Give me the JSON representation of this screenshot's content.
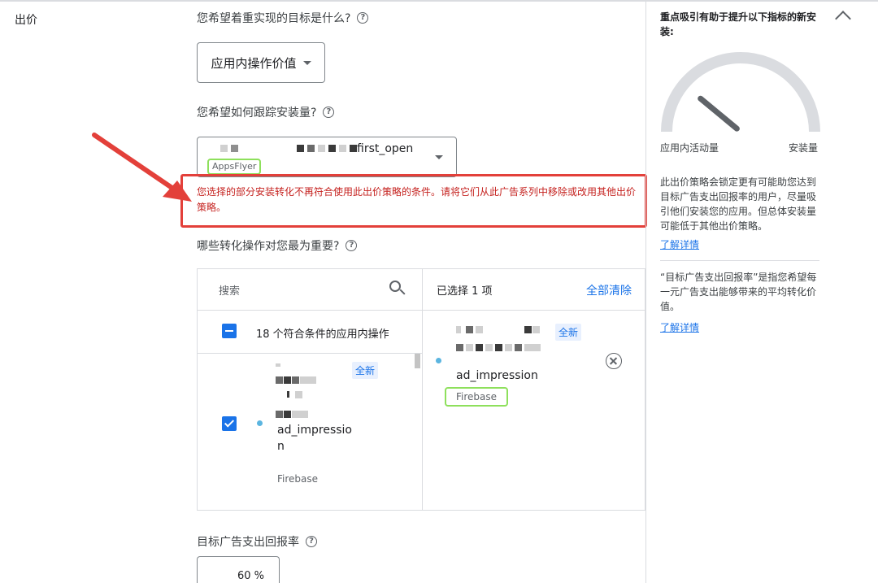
{
  "section": {
    "title": "出价"
  },
  "goal": {
    "question": "您希望着重实现的目标是什么?",
    "selected": "应用内操作价值"
  },
  "tracking": {
    "question": "您希望如何跟踪安装量?",
    "event_name": "first_open",
    "source": "AppsFlyer"
  },
  "error": {
    "message": "您选择的部分安装转化不再符合使用此出价策略的条件。请将它们从此广告系列中移除或改用其他出价策略。"
  },
  "conversions": {
    "question": "哪些转化操作对您最为重要?",
    "search_placeholder": "搜索",
    "selected_count": "已选择 1 项",
    "clear_all": "全部清除",
    "group_label": "18 个符合条件的应用内操作",
    "available_items": [
      {
        "name_line1": "ad_impressio",
        "name_line2": "n",
        "source": "Firebase",
        "badge": "全新"
      }
    ],
    "selected_items": [
      {
        "name": "ad_impression",
        "source": "Firebase",
        "badge": "全新"
      }
    ]
  },
  "roas": {
    "label": "目标广告支出回报率",
    "value": "60 %"
  },
  "side_panel": {
    "title": "重点吸引有助于提升以下指标的新安装:",
    "gauge_min_label": "应用内活动量",
    "gauge_max_label": "安装量",
    "gauge_level": 0.22,
    "description": "此出价策略会锁定更有可能助您达到目标广告支出回报率的用户，尽量吸引他们安装您的应用。但总体安装量可能低于其他出价策略。",
    "learn_more_1": "了解详情",
    "roas_definition": "“目标广告支出回报率”是指您希望每一元广告支出能够带来的平均转化价值。",
    "learn_more_2": "了解详情"
  },
  "colors": {
    "accent_blue": "#1a73e8",
    "error_red": "#c5221f",
    "annotation_red": "#e3403a",
    "annotation_green": "#8ee05c"
  }
}
